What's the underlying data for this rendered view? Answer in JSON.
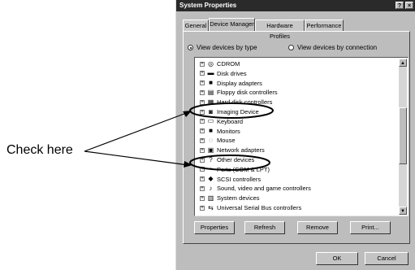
{
  "annotation": {
    "text": "Check here"
  },
  "window": {
    "title": "System Properties",
    "help_glyph": "?",
    "close_glyph": "×"
  },
  "tabs": [
    {
      "label": "General",
      "active": false
    },
    {
      "label": "Device Manager",
      "active": true
    },
    {
      "label": "Hardware Profiles",
      "active": false
    },
    {
      "label": "Performance",
      "active": false
    }
  ],
  "view_options": {
    "by_type": {
      "label": "View devices by type",
      "selected": true
    },
    "by_connection": {
      "label": "View devices by connection",
      "selected": false
    }
  },
  "device_list": [
    {
      "label": "CDROM",
      "icon": "cdrom-icon",
      "glyph": "◎"
    },
    {
      "label": "Disk drives",
      "icon": "disk-drive-icon",
      "glyph": "▬"
    },
    {
      "label": "Display adapters",
      "icon": "monitor-icon",
      "glyph": "■"
    },
    {
      "label": "Floppy disk controllers",
      "icon": "floppy-icon",
      "glyph": "▤"
    },
    {
      "label": "Hard disk controllers",
      "icon": "controller-icon",
      "glyph": "▦"
    },
    {
      "label": "Imaging Device",
      "icon": "camera-icon",
      "glyph": "◙"
    },
    {
      "label": "Keyboard",
      "icon": "keyboard-icon",
      "glyph": "▭"
    },
    {
      "label": "Monitors",
      "icon": "monitor-icon",
      "glyph": "■"
    },
    {
      "label": "Mouse",
      "icon": "mouse-icon",
      "glyph": "◌"
    },
    {
      "label": "Network adapters",
      "icon": "network-icon",
      "glyph": "▣"
    },
    {
      "label": "Other devices",
      "icon": "question-icon",
      "glyph": "?"
    },
    {
      "label": "Ports (COM & LPT)",
      "icon": "port-icon",
      "glyph": "▪"
    },
    {
      "label": "SCSI controllers",
      "icon": "scsi-icon",
      "glyph": "◆"
    },
    {
      "label": "Sound, video and game controllers",
      "icon": "speaker-icon",
      "glyph": "♪"
    },
    {
      "label": "System devices",
      "icon": "computer-icon",
      "glyph": "▥"
    },
    {
      "label": "Universal Serial Bus controllers",
      "icon": "usb-icon",
      "glyph": "⇆"
    }
  ],
  "expander_glyph": "+",
  "scrollbar": {
    "up_glyph": "▲",
    "down_glyph": "▼"
  },
  "action_buttons": {
    "properties": "Properties",
    "refresh": "Refresh",
    "remove": "Remove",
    "print": "Print..."
  },
  "dialog_buttons": {
    "ok": "OK",
    "cancel": "Cancel"
  }
}
